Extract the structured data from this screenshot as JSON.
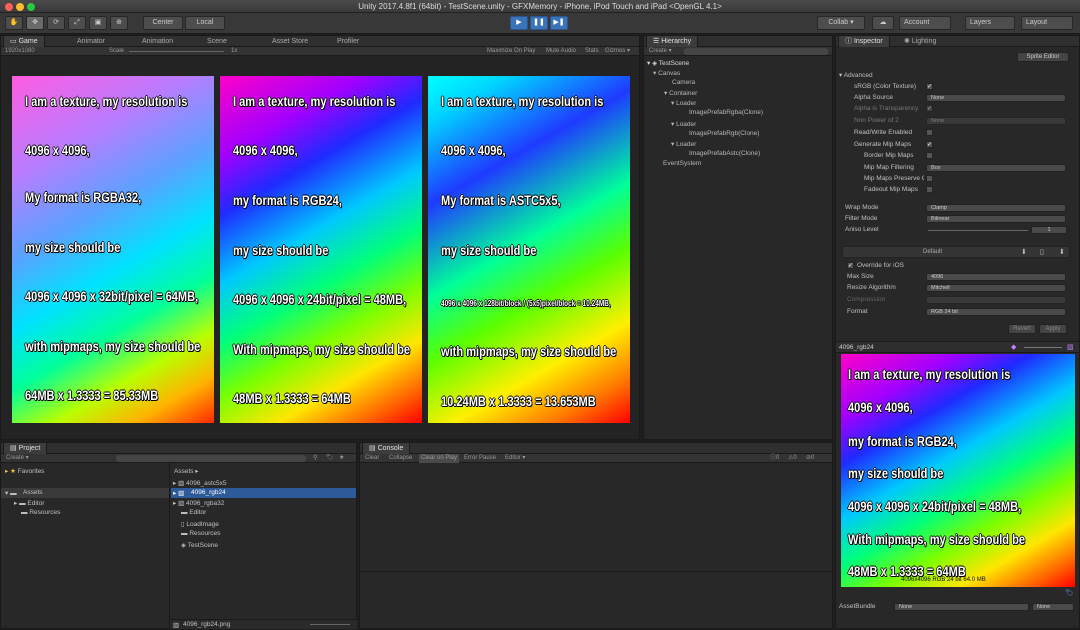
{
  "window": {
    "title": "Unity 2017.4.8f1 (64bit) - TestScene.unity - GFXMemory - iPhone, iPod Touch and iPad <OpenGL 4.1>"
  },
  "toolbar": {
    "pivot": "Center",
    "space": "Local",
    "collab": "Collab ▾",
    "account": "Account",
    "layers": "Layers",
    "layout": "Layout"
  },
  "game": {
    "tabs": [
      "Game",
      "Animator",
      "Animation",
      "Scene",
      "Asset Store",
      "Profiler"
    ],
    "resolution": "1920x1080",
    "scale_label": "Scale",
    "scale_value": "1x",
    "options": [
      "Maximize On Play",
      "Mute Audio",
      "Stats",
      "Gizmos ▾"
    ]
  },
  "textures": [
    {
      "lines": [
        "I am a texture, my resolution is",
        "4096 x 4096,",
        "My format is RGBA32,",
        "my size should be",
        "4096 x 4096 x 32bit/pixel = 64MB,",
        "with mipmaps, my size should be",
        "64MB x 1.3333 = 85.33MB"
      ]
    },
    {
      "lines": [
        "I am a texture, my resolution is",
        "4096 x 4096,",
        "my format is RGB24,",
        "my size should be",
        "4096 x 4096 x 24bit/pixel = 48MB,",
        "With mipmaps, my size should be",
        "48MB x 1.3333 = 64MB"
      ]
    },
    {
      "lines": [
        "I am a texture, my resolution is",
        "4096 x 4096,",
        "My format is ASTC5x5,",
        "my size should be",
        "4096 x 4096 x 128bit/block / (5x5)pixel/block = 10.24MB,",
        "with mipmaps, my size should be",
        "10.24MB x 1.3333 = 13.653MB"
      ]
    }
  ],
  "hierarchy": {
    "tab": "Hierarchy",
    "create": "Create ▾",
    "items": [
      "TestScene",
      "Canvas",
      "Camera",
      "Container",
      "Loader",
      "ImagePrefabRgba(Clone)",
      "Loader",
      "ImagePrefabRgb(Clone)",
      "Loader",
      "ImagePrefabAstc(Clone)",
      "EventSystem"
    ]
  },
  "inspector": {
    "tabs": [
      "Inspector",
      "Lighting"
    ],
    "sprite_editor": "Sprite Editor",
    "advanced": "Advanced",
    "props": [
      {
        "label": "sRGB (Color Texture)",
        "check": "✓"
      },
      {
        "label": "Alpha Source",
        "value": "None"
      },
      {
        "label": "Alpha is Transparency",
        "check": "✓"
      },
      {
        "label": "Non Power of 2",
        "value": "None"
      },
      {
        "label": "Read/Write Enabled",
        "check": ""
      },
      {
        "label": "Generate Mip Maps",
        "check": "✓"
      },
      {
        "label": "Border Mip Maps",
        "check": ""
      },
      {
        "label": "Mip Map Filtering",
        "value": "Box"
      },
      {
        "label": "Mip Maps Preserve Coverage",
        "check": ""
      },
      {
        "label": "Fadeout Mip Maps",
        "check": ""
      }
    ],
    "wrap_mode": {
      "label": "Wrap Mode",
      "value": "Clamp"
    },
    "filter_mode": {
      "label": "Filter Mode",
      "value": "Bilinear"
    },
    "aniso": {
      "label": "Aniso Level",
      "value": "1"
    },
    "platform": "Default",
    "override": "Override for iOS",
    "platform_props": [
      {
        "label": "Max Size",
        "value": "4096"
      },
      {
        "label": "Resize Algorithm",
        "value": "Mitchell"
      },
      {
        "label": "Compression",
        "value": ""
      },
      {
        "label": "Format",
        "value": "RGB 24 bit"
      }
    ],
    "revert": "Revert",
    "apply": "Apply",
    "preview_name": "4096_rgb24",
    "preview_lines": [
      "I am a texture, my resolution is",
      "4096 x 4096,",
      "my format is RGB24,",
      "my size should be",
      "4096 x 4096 x 24bit/pixel = 48MB,",
      "With mipmaps, my size should be",
      "48MB x 1.3333 = 64MB"
    ],
    "preview_info": "4096x4096  RGB 24 bit   64.0 MB",
    "assetbundle": {
      "label": "AssetBundle",
      "value": "None",
      "variant": "None"
    }
  },
  "project": {
    "tab": "Project",
    "create": "Create ▾",
    "favorites": "Favorites",
    "assets_root": "Assets",
    "folders": [
      "Editor",
      "Resources"
    ],
    "breadcrumb": "Assets ▸",
    "files": [
      "4096_astc5x5",
      "4096_rgb24",
      "4096_rgba32",
      "Editor",
      "LoadImage",
      "Resources",
      "TestScene"
    ],
    "selected_file": "4096_rgb24.png"
  },
  "console": {
    "tab": "Console",
    "buttons": [
      "Clear",
      "Collapse",
      "Clear on Play",
      "Error Pause",
      "Editor ▾"
    ],
    "counts": [
      "0",
      "0",
      "0"
    ]
  }
}
